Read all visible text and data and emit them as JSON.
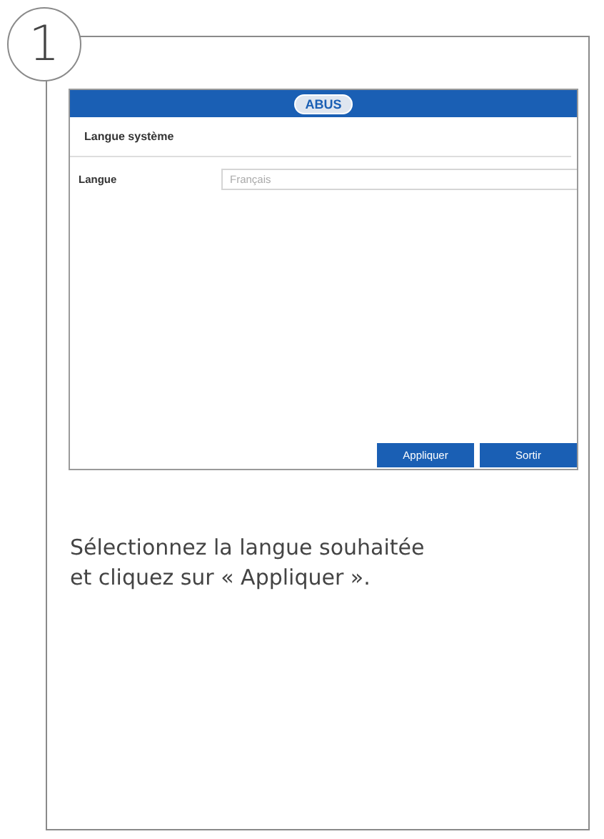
{
  "step": {
    "number": "1"
  },
  "screen": {
    "logo": "ABUS",
    "section_title": "Langue système",
    "fields": [
      {
        "label": "Langue",
        "value": "Français"
      }
    ],
    "buttons": [
      "Appliquer",
      "Sortir"
    ]
  },
  "caption": "Sélectionnez la langue souhaitée et cliquez sur « Appliquer »."
}
